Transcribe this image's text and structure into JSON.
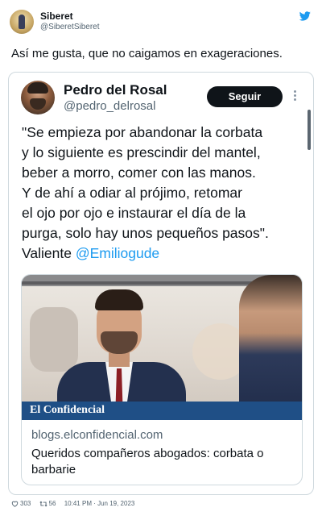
{
  "tweet": {
    "author_name": "Siberet",
    "author_handle": "@SiberetSiberet",
    "text": "Así me gusta, que no caigamos en exageraciones.",
    "footer": {
      "likes": "303",
      "retweets": "56",
      "timestamp": "10:41 PM · Jun 19, 2023"
    }
  },
  "quoted": {
    "author_name": "Pedro del Rosal",
    "author_handle": "@pedro_delrosal",
    "follow_label": "Seguir",
    "text_lines": [
      "\"Se empieza por abandonar la corbata",
      "y lo siguiente es prescindir del mantel,",
      "beber a morro, comer con las manos.",
      "Y de ahí a odiar al prójimo, retomar",
      "el ojo por ojo e instaurar el día de la",
      "purga, solo hay unos pequeños pasos\"."
    ],
    "last_line_prefix": "Valiente ",
    "mention": "@Emiliogude",
    "link_card": {
      "banner": "El Confidencial",
      "domain": "blogs.elconfidencial.com",
      "title": "Queridos compañeros abogados: corbata o barbarie"
    }
  },
  "colors": {
    "link_blue": "#1d9bf0",
    "twitter_blue": "#1d9bf0",
    "banner_blue": "#1f4f86",
    "follow_button_bg": "#0f1419"
  },
  "icons": [
    "twitter-bird-icon",
    "more-vertical-icon",
    "heart-icon",
    "retweet-icon"
  ]
}
